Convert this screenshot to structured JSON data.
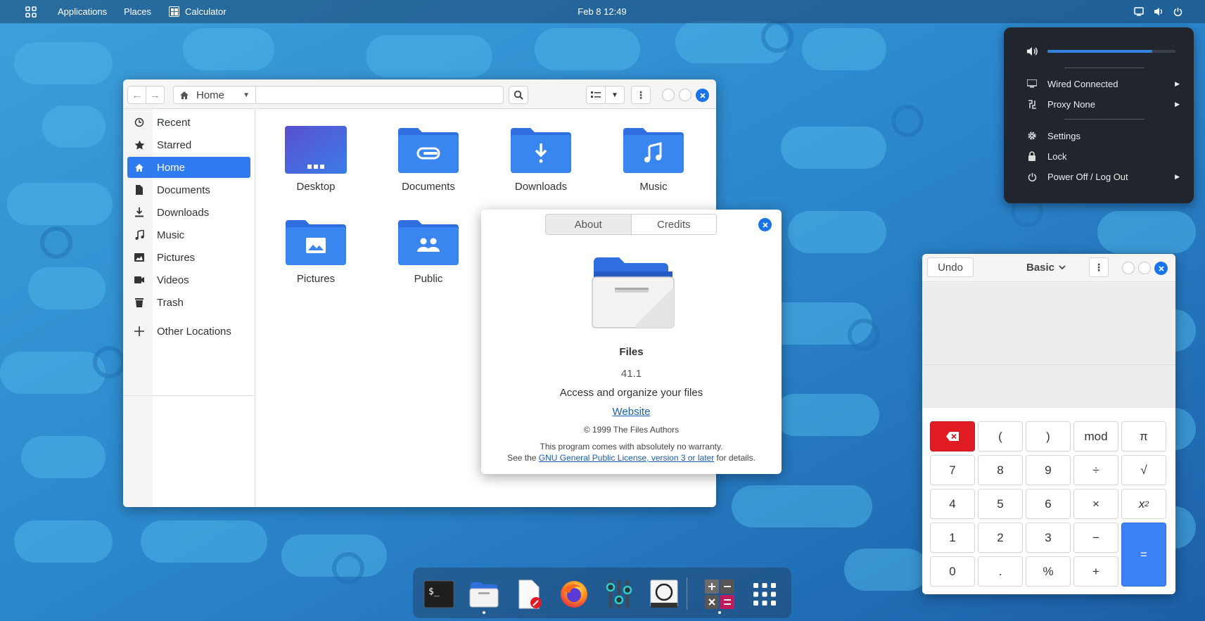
{
  "topbar": {
    "applications": "Applications",
    "places": "Places",
    "active_app": "Calculator",
    "clock": "Feb 8  12:49",
    "status_icons": [
      "screen-icon",
      "volume-icon",
      "power-icon"
    ]
  },
  "files": {
    "path_label": "Home",
    "sidebar": [
      {
        "label": "Recent",
        "icon": "clock-icon"
      },
      {
        "label": "Starred",
        "icon": "star-icon"
      },
      {
        "label": "Home",
        "icon": "home-icon",
        "active": true
      },
      {
        "label": "Documents",
        "icon": "document-icon"
      },
      {
        "label": "Downloads",
        "icon": "download-icon"
      },
      {
        "label": "Music",
        "icon": "music-icon"
      },
      {
        "label": "Pictures",
        "icon": "picture-icon"
      },
      {
        "label": "Videos",
        "icon": "video-icon"
      },
      {
        "label": "Trash",
        "icon": "trash-icon"
      },
      {
        "label": "Other Locations",
        "icon": "plus-icon"
      }
    ],
    "folders": [
      {
        "label": "Desktop",
        "icon": "desktop-folder-icon"
      },
      {
        "label": "Documents",
        "icon": "documents-folder-icon"
      },
      {
        "label": "Downloads",
        "icon": "downloads-folder-icon"
      },
      {
        "label": "Music",
        "icon": "music-folder-icon"
      },
      {
        "label": "Pictures",
        "icon": "pictures-folder-icon"
      },
      {
        "label": "Public",
        "icon": "public-folder-icon"
      }
    ]
  },
  "about": {
    "tabs": [
      "About",
      "Credits"
    ],
    "active_tab": "About",
    "app_name": "Files",
    "version": "41.1",
    "description": "Access and organize your files",
    "website": "Website",
    "copyright": "© 1999 The Files Authors",
    "warranty": "This program comes with absolutely no warranty.",
    "license_prefix": "See the ",
    "license_link": "GNU General Public License, version 3 or later",
    "license_suffix": " for details."
  },
  "status_menu": {
    "volume_level": 0.82,
    "items": [
      {
        "label": "Wired Connected",
        "icon": "network-icon",
        "has_submenu": true
      },
      {
        "label": "Proxy None",
        "icon": "proxy-icon",
        "has_submenu": true
      },
      {
        "label": "Settings",
        "icon": "gear-icon",
        "has_submenu": false
      },
      {
        "label": "Lock",
        "icon": "lock-icon",
        "has_submenu": false
      },
      {
        "label": "Power Off / Log Out",
        "icon": "power-icon",
        "has_submenu": true
      }
    ]
  },
  "calculator": {
    "undo": "Undo",
    "mode": "Basic",
    "keys": {
      "row1": [
        "⌫",
        "(",
        ")",
        "mod",
        "π"
      ],
      "row2": [
        "7",
        "8",
        "9",
        "÷",
        "√"
      ],
      "row3": [
        "4",
        "5",
        "6",
        "×",
        "x²"
      ],
      "row4": [
        "1",
        "2",
        "3",
        "−"
      ],
      "row5": [
        "0",
        ".",
        "%",
        "+"
      ],
      "equals": "="
    }
  },
  "dock": {
    "apps": [
      "terminal-icon",
      "files-icon",
      "text-editor-icon",
      "firefox-icon",
      "settings-mixer-icon",
      "screenshot-icon",
      "calculator-icon",
      "app-grid-icon"
    ]
  },
  "colors": {
    "accent": "#2f7bf0",
    "close": "#1a73e8",
    "delete_key": "#e01b24",
    "equals_key": "#3c82f6",
    "menu_bg": "#20252e"
  }
}
